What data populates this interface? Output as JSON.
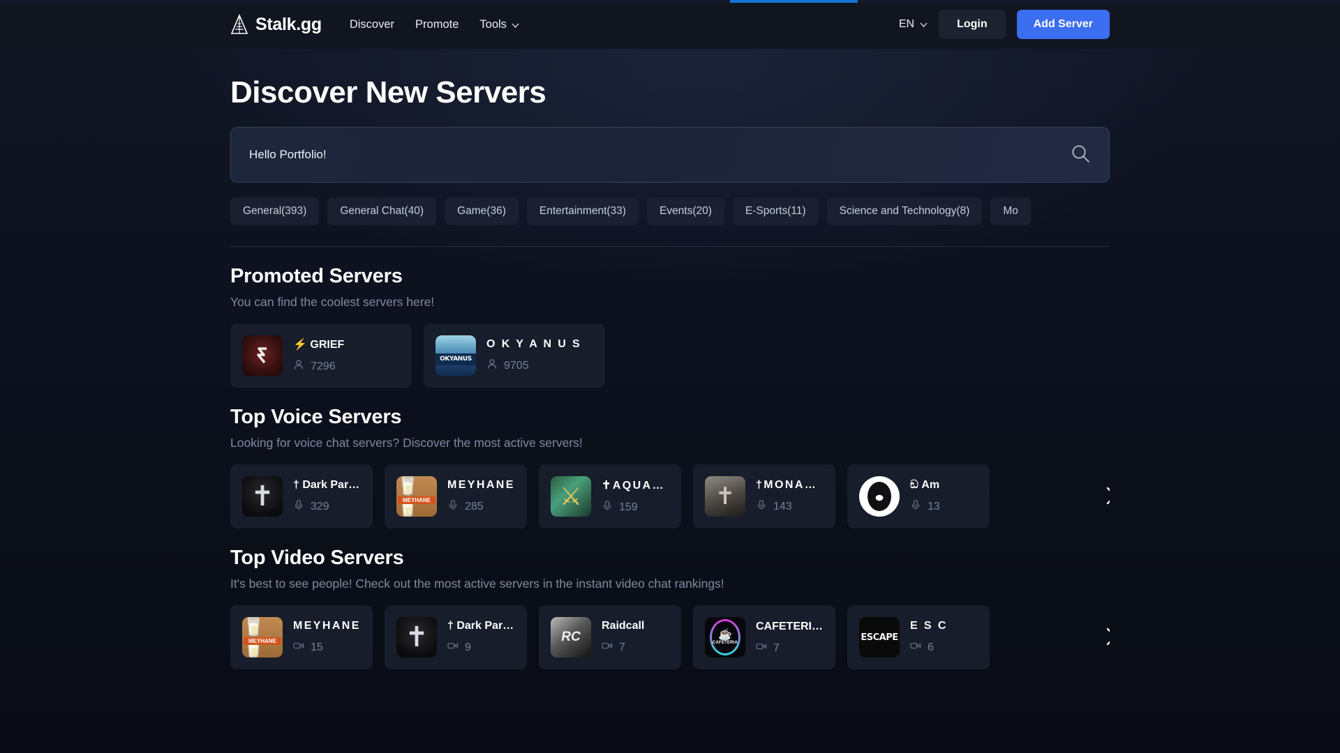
{
  "header": {
    "brand": "Stalk.gg",
    "brand_icon": "triangle-cone-icon",
    "nav": [
      {
        "label": "Discover",
        "icon": null
      },
      {
        "label": "Promote",
        "icon": null
      },
      {
        "label": "Tools",
        "icon": "chevron-down-icon"
      }
    ],
    "language": "EN",
    "login_label": "Login",
    "add_server_label": "Add Server",
    "accent_color": "#3b6ef0"
  },
  "page": {
    "title": "Discover New Servers"
  },
  "search": {
    "value": "Hello Portfolio!",
    "placeholder": "Hello Portfolio!",
    "icon": "search-icon"
  },
  "categories": [
    {
      "label": "General(393)"
    },
    {
      "label": "General Chat(40)"
    },
    {
      "label": "Game(36)"
    },
    {
      "label": "Entertainment(33)"
    },
    {
      "label": "Events(20)"
    },
    {
      "label": "E-Sports(11)"
    },
    {
      "label": "Science and Technology(8)"
    },
    {
      "label": "Mo"
    }
  ],
  "promoted": {
    "title": "Promoted Servers",
    "subtitle": "You can find the coolest servers here!",
    "cards": [
      {
        "name": "⚡ GRIEF",
        "count": "7296",
        "meta_icon": "member-icon",
        "spaced": false
      },
      {
        "name": "O K Y A N U S",
        "count": "9705",
        "meta_icon": "member-icon",
        "spaced": false
      }
    ]
  },
  "voice": {
    "title": "Top Voice Servers",
    "subtitle": "Looking for voice chat servers? Discover the most active servers!",
    "next_icon": "chevron-right-icon",
    "cards": [
      {
        "name": "† Dark Paradise …",
        "count": "329",
        "meta_icon": "microphone-icon",
        "spaced": false
      },
      {
        "name": "MEYHANE",
        "count": "285",
        "meta_icon": "microphone-icon",
        "spaced": true
      },
      {
        "name": "✝AQUALITY",
        "count": "159",
        "meta_icon": "microphone-icon",
        "spaced": true
      },
      {
        "name": "†MONARCH",
        "count": "143",
        "meta_icon": "microphone-icon",
        "spaced": true
      },
      {
        "name": "ඞ Am",
        "count": "13",
        "meta_icon": "microphone-icon",
        "spaced": false
      }
    ]
  },
  "video": {
    "title": "Top Video Servers",
    "subtitle": "It's best to see people! Check out the most active servers in the instant video chat rankings!",
    "next_icon": "chevron-right-icon",
    "cards": [
      {
        "name": "MEYHANE",
        "count": "15",
        "meta_icon": "video-camera-icon",
        "spaced": true
      },
      {
        "name": "† Dark Paradise …",
        "count": "9",
        "meta_icon": "video-camera-icon",
        "spaced": false
      },
      {
        "name": "Raidcall",
        "count": "7",
        "meta_icon": "video-camera-icon",
        "spaced": false
      },
      {
        "name": "CAFETERIA ☕",
        "count": "7",
        "meta_icon": "video-camera-icon",
        "spaced": false
      },
      {
        "name": "E S C",
        "count": "6",
        "meta_icon": "video-camera-icon",
        "spaced": true
      }
    ]
  }
}
